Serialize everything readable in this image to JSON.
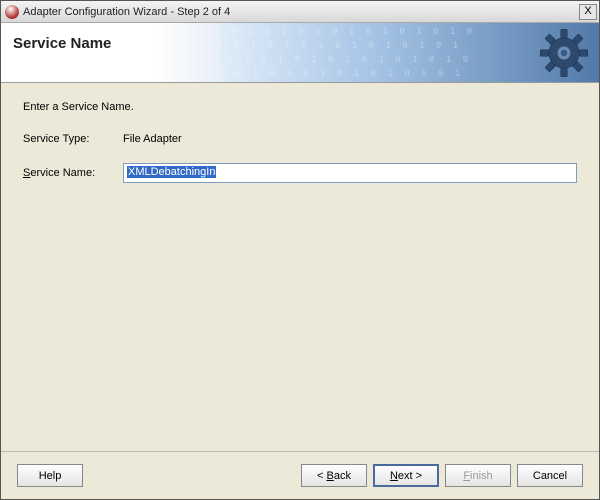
{
  "titlebar": {
    "text": "Adapter Configuration Wizard - Step 2 of 4",
    "close": "X"
  },
  "banner": {
    "title": "Service Name"
  },
  "content": {
    "intro": "Enter a Service Name.",
    "service_type_label": "Service Type:",
    "service_type_value": "File Adapter",
    "service_name_label_pre": "S",
    "service_name_label_rest": "ervice Name:",
    "service_name_value": "XMLDebatchingIn"
  },
  "footer": {
    "help": "Help",
    "back_pre": "< ",
    "back_u": "B",
    "back_rest": "ack",
    "next_u": "N",
    "next_rest": "ext >",
    "finish_u": "F",
    "finish_rest": "inish",
    "cancel": "Cancel"
  }
}
